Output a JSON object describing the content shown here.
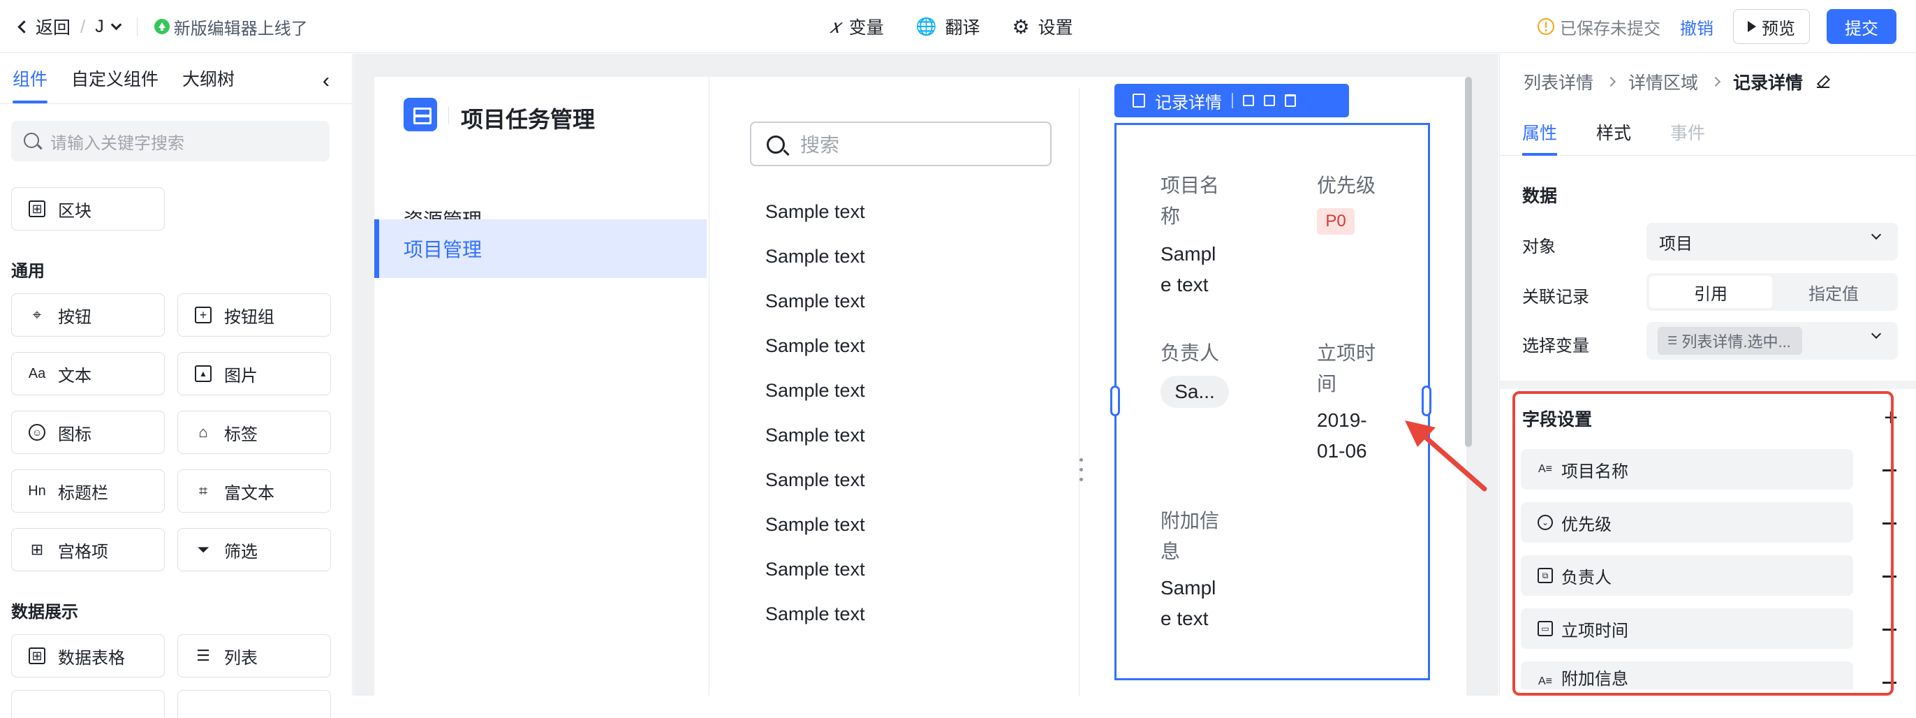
{
  "topbar": {
    "back_label": "返回",
    "app_name": "J",
    "notice": "新版编辑器上线了",
    "center": [
      {
        "icon": "x-variable-icon",
        "glyph": "𝑥",
        "label": "变量"
      },
      {
        "icon": "globe-icon",
        "glyph": "🌐",
        "label": "翻译"
      },
      {
        "icon": "gear-icon",
        "glyph": "⚙",
        "label": "设置"
      }
    ],
    "save_status": "已保存未提交",
    "undo": "撤销",
    "preview": "预览",
    "submit": "提交"
  },
  "left": {
    "tabs": [
      "组件",
      "自定义组件",
      "大纲树"
    ],
    "collapse_icon": "double-chevron-left-icon",
    "search_placeholder": "请输入关键字搜索",
    "block": "区块",
    "section_common": "通用",
    "common": [
      "按钮",
      "按钮组",
      "文本",
      "图片",
      "图标",
      "标签",
      "标题栏",
      "富文本",
      "宫格项",
      "筛选"
    ],
    "section_data": "数据展示",
    "data": [
      "数据表格",
      "列表"
    ]
  },
  "nav": {
    "title": "项目任务管理",
    "items": [
      "资源管理",
      "项目管理"
    ]
  },
  "list": {
    "search_placeholder": "搜索",
    "rows": [
      "Sample text",
      "Sample text",
      "Sample text",
      "Sample text",
      "Sample text",
      "Sample text",
      "Sample text",
      "Sample text",
      "Sample text",
      "Sample text"
    ]
  },
  "detail": {
    "toolbar_label": "记录详情",
    "fields": {
      "name_label_1": "项目名",
      "name_label_2": "称",
      "name_value_1": "Sampl",
      "name_value_2": "e text",
      "priority_label": "优先级",
      "priority_tag": "P0",
      "owner_label": "负责人",
      "owner_value": "Sa...",
      "date_label_1": "立项时",
      "date_label_2": "间",
      "date_value_1": "2019-",
      "date_value_2": "01-06",
      "extra_label_1": "附加信",
      "extra_label_2": "息",
      "extra_value_1": "Sampl",
      "extra_value_2": "e text"
    }
  },
  "right": {
    "breadcrumb": [
      "列表详情",
      "详情区域",
      "记录详情"
    ],
    "tabs": [
      "属性",
      "样式",
      "事件"
    ],
    "data_head": "数据",
    "object_label": "对象",
    "object_value": "项目",
    "relation_label": "关联记录",
    "relation_options": [
      "引用",
      "指定值"
    ],
    "variable_label": "选择变量",
    "variable_value": "列表详情.选中...",
    "field_settings": "字段设置",
    "fields": [
      "项目名称",
      "优先级",
      "负责人",
      "立项时间",
      "附加信息"
    ]
  },
  "colors": {
    "accent": "#3370ff",
    "highlight": "#e8463a",
    "tag_bg": "#fde2e2",
    "tag_fg": "#d83931"
  }
}
